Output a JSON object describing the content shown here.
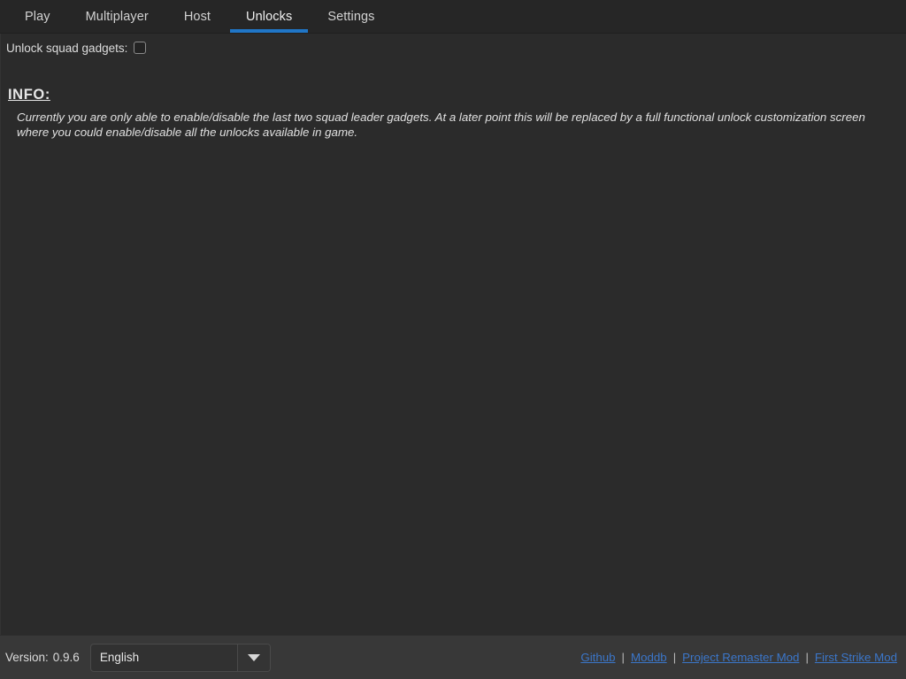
{
  "window": {
    "background_color": "#2b2b2b",
    "accent_color": "#2076c7",
    "link_color": "#3b76c9"
  },
  "tabs": [
    {
      "label": "Play",
      "active": false
    },
    {
      "label": "Multiplayer",
      "active": false
    },
    {
      "label": "Host",
      "active": false
    },
    {
      "label": "Unlocks",
      "active": true
    },
    {
      "label": "Settings",
      "active": false
    }
  ],
  "main": {
    "checkbox": {
      "label": "Unlock squad gadgets:",
      "checked": false
    },
    "info": {
      "heading": "INFO:",
      "text": "Currently you are only able to enable/disable the last two squad leader gadgets. At a later point this will be replaced by a full functional unlock customization screen where you could enable/disable all the unlocks available in game."
    }
  },
  "footer": {
    "version_label": "Version:",
    "version_value": "0.9.6",
    "language": {
      "selected": "English",
      "arrow_icon": "chevron-down-icon"
    },
    "links": [
      {
        "label": "Github"
      },
      {
        "label": "Moddb"
      },
      {
        "label": "Project Remaster Mod"
      },
      {
        "label": "First Strike Mod"
      }
    ],
    "separator": "|"
  }
}
